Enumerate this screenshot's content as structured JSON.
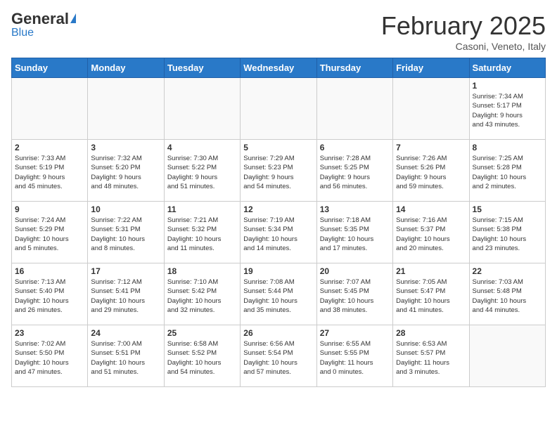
{
  "header": {
    "logo_general": "General",
    "logo_blue": "Blue",
    "month": "February 2025",
    "location": "Casoni, Veneto, Italy"
  },
  "weekdays": [
    "Sunday",
    "Monday",
    "Tuesday",
    "Wednesday",
    "Thursday",
    "Friday",
    "Saturday"
  ],
  "weeks": [
    [
      {
        "day": "",
        "info": ""
      },
      {
        "day": "",
        "info": ""
      },
      {
        "day": "",
        "info": ""
      },
      {
        "day": "",
        "info": ""
      },
      {
        "day": "",
        "info": ""
      },
      {
        "day": "",
        "info": ""
      },
      {
        "day": "1",
        "info": "Sunrise: 7:34 AM\nSunset: 5:17 PM\nDaylight: 9 hours\nand 43 minutes."
      }
    ],
    [
      {
        "day": "2",
        "info": "Sunrise: 7:33 AM\nSunset: 5:19 PM\nDaylight: 9 hours\nand 45 minutes."
      },
      {
        "day": "3",
        "info": "Sunrise: 7:32 AM\nSunset: 5:20 PM\nDaylight: 9 hours\nand 48 minutes."
      },
      {
        "day": "4",
        "info": "Sunrise: 7:30 AM\nSunset: 5:22 PM\nDaylight: 9 hours\nand 51 minutes."
      },
      {
        "day": "5",
        "info": "Sunrise: 7:29 AM\nSunset: 5:23 PM\nDaylight: 9 hours\nand 54 minutes."
      },
      {
        "day": "6",
        "info": "Sunrise: 7:28 AM\nSunset: 5:25 PM\nDaylight: 9 hours\nand 56 minutes."
      },
      {
        "day": "7",
        "info": "Sunrise: 7:26 AM\nSunset: 5:26 PM\nDaylight: 9 hours\nand 59 minutes."
      },
      {
        "day": "8",
        "info": "Sunrise: 7:25 AM\nSunset: 5:28 PM\nDaylight: 10 hours\nand 2 minutes."
      }
    ],
    [
      {
        "day": "9",
        "info": "Sunrise: 7:24 AM\nSunset: 5:29 PM\nDaylight: 10 hours\nand 5 minutes."
      },
      {
        "day": "10",
        "info": "Sunrise: 7:22 AM\nSunset: 5:31 PM\nDaylight: 10 hours\nand 8 minutes."
      },
      {
        "day": "11",
        "info": "Sunrise: 7:21 AM\nSunset: 5:32 PM\nDaylight: 10 hours\nand 11 minutes."
      },
      {
        "day": "12",
        "info": "Sunrise: 7:19 AM\nSunset: 5:34 PM\nDaylight: 10 hours\nand 14 minutes."
      },
      {
        "day": "13",
        "info": "Sunrise: 7:18 AM\nSunset: 5:35 PM\nDaylight: 10 hours\nand 17 minutes."
      },
      {
        "day": "14",
        "info": "Sunrise: 7:16 AM\nSunset: 5:37 PM\nDaylight: 10 hours\nand 20 minutes."
      },
      {
        "day": "15",
        "info": "Sunrise: 7:15 AM\nSunset: 5:38 PM\nDaylight: 10 hours\nand 23 minutes."
      }
    ],
    [
      {
        "day": "16",
        "info": "Sunrise: 7:13 AM\nSunset: 5:40 PM\nDaylight: 10 hours\nand 26 minutes."
      },
      {
        "day": "17",
        "info": "Sunrise: 7:12 AM\nSunset: 5:41 PM\nDaylight: 10 hours\nand 29 minutes."
      },
      {
        "day": "18",
        "info": "Sunrise: 7:10 AM\nSunset: 5:42 PM\nDaylight: 10 hours\nand 32 minutes."
      },
      {
        "day": "19",
        "info": "Sunrise: 7:08 AM\nSunset: 5:44 PM\nDaylight: 10 hours\nand 35 minutes."
      },
      {
        "day": "20",
        "info": "Sunrise: 7:07 AM\nSunset: 5:45 PM\nDaylight: 10 hours\nand 38 minutes."
      },
      {
        "day": "21",
        "info": "Sunrise: 7:05 AM\nSunset: 5:47 PM\nDaylight: 10 hours\nand 41 minutes."
      },
      {
        "day": "22",
        "info": "Sunrise: 7:03 AM\nSunset: 5:48 PM\nDaylight: 10 hours\nand 44 minutes."
      }
    ],
    [
      {
        "day": "23",
        "info": "Sunrise: 7:02 AM\nSunset: 5:50 PM\nDaylight: 10 hours\nand 47 minutes."
      },
      {
        "day": "24",
        "info": "Sunrise: 7:00 AM\nSunset: 5:51 PM\nDaylight: 10 hours\nand 51 minutes."
      },
      {
        "day": "25",
        "info": "Sunrise: 6:58 AM\nSunset: 5:52 PM\nDaylight: 10 hours\nand 54 minutes."
      },
      {
        "day": "26",
        "info": "Sunrise: 6:56 AM\nSunset: 5:54 PM\nDaylight: 10 hours\nand 57 minutes."
      },
      {
        "day": "27",
        "info": "Sunrise: 6:55 AM\nSunset: 5:55 PM\nDaylight: 11 hours\nand 0 minutes."
      },
      {
        "day": "28",
        "info": "Sunrise: 6:53 AM\nSunset: 5:57 PM\nDaylight: 11 hours\nand 3 minutes."
      },
      {
        "day": "",
        "info": ""
      }
    ]
  ]
}
